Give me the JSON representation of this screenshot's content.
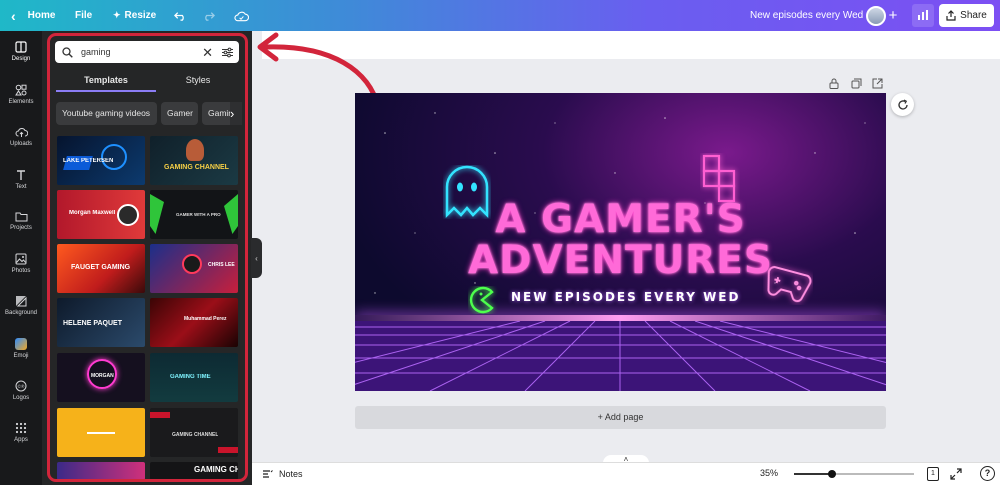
{
  "topbar": {
    "home_label": "Home",
    "file_label": "File",
    "resize_label": "Resize",
    "design_title": "New episodes every Wed",
    "share_label": "Share"
  },
  "rail": {
    "items": [
      {
        "label": "Design",
        "icon": "design-icon"
      },
      {
        "label": "Elements",
        "icon": "elements-icon"
      },
      {
        "label": "Uploads",
        "icon": "uploads-icon"
      },
      {
        "label": "Text",
        "icon": "text-icon"
      },
      {
        "label": "Projects",
        "icon": "projects-icon"
      },
      {
        "label": "Photos",
        "icon": "photos-icon"
      },
      {
        "label": "Background",
        "icon": "background-icon"
      },
      {
        "label": "Emoji",
        "icon": "emoji-icon"
      },
      {
        "label": "Logos",
        "icon": "logos-icon"
      },
      {
        "label": "Apps",
        "icon": "apps-icon"
      }
    ]
  },
  "panel": {
    "search_value": "gaming",
    "tabs": [
      "Templates",
      "Styles"
    ],
    "active_tab": "Templates",
    "chips": [
      "Youtube gaming videos",
      "Gamer",
      "Gaming"
    ],
    "templates": [
      {
        "text": "LAKE PETERSEN"
      },
      {
        "text": "GAMING CHANNEL"
      },
      {
        "text": "Morgan Maxwell"
      },
      {
        "text": "GAMER WITH A PRO"
      },
      {
        "text": "FAUGET GAMING"
      },
      {
        "text": "CHRIS LEE"
      },
      {
        "text": "HELENE PAQUET"
      },
      {
        "text": "Muhammad Perez"
      },
      {
        "text": "MORGAN"
      },
      {
        "text": "GAMING TIME"
      },
      {
        "text": ""
      },
      {
        "text": "GAMING CHANNEL"
      },
      {
        "text": ""
      },
      {
        "text": "GAMING CHANNEL"
      }
    ]
  },
  "design": {
    "title_line1": "A GAMER'S",
    "title_line2": "ADVENTURES",
    "subtitle": "NEW EPISODES EVERY WED"
  },
  "canvas": {
    "add_page_label": "+ Add page"
  },
  "bottombar": {
    "notes_label": "Notes",
    "zoom": "35%",
    "zoom_fraction": 0.35,
    "page_count": "1"
  },
  "colors": {
    "accent": "#7c4ff3",
    "highlight": "#d2253b",
    "neon_pink": "#ff5fd2",
    "neon_cyan": "#33e3ff",
    "neon_green": "#4dff4d"
  }
}
